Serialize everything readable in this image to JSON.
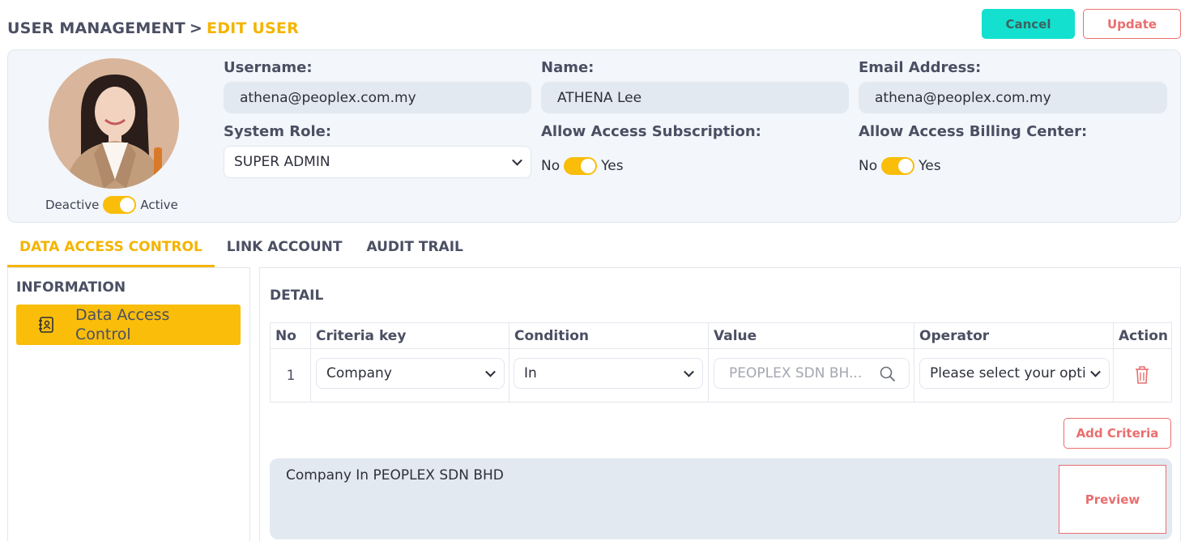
{
  "breadcrumb": {
    "root": "USER MANAGEMENT",
    "separator": ">",
    "current": "EDIT USER"
  },
  "actions": {
    "cancel_label": "Cancel",
    "update_label": "Update"
  },
  "profile": {
    "status_off_label": "Deactive",
    "status_on_label": "Active",
    "status_active": true,
    "username_label": "Username:",
    "username_value": "athena@peoplex.com.my",
    "name_label": "Name:",
    "name_value": "ATHENA Lee",
    "email_label": "Email Address:",
    "email_value": "athena@peoplex.com.my",
    "role_label": "System Role:",
    "role_value": "SUPER ADMIN",
    "subscription_label": "Allow Access Subscription:",
    "subscription_no": "No",
    "subscription_yes": "Yes",
    "subscription_enabled": true,
    "billing_label": "Allow Access Billing Center:",
    "billing_no": "No",
    "billing_yes": "Yes",
    "billing_enabled": true
  },
  "tabs": [
    {
      "label": "DATA ACCESS CONTROL",
      "active": true
    },
    {
      "label": "LINK ACCOUNT",
      "active": false
    },
    {
      "label": "AUDIT TRAIL",
      "active": false
    }
  ],
  "sidebar": {
    "title": "INFORMATION",
    "items": [
      {
        "label": "Data Access Control",
        "icon": "contact-book-icon",
        "active": true
      }
    ]
  },
  "detail": {
    "title": "DETAIL",
    "columns": [
      "No",
      "Criteria key",
      "Condition",
      "Value",
      "Operator",
      "Action"
    ],
    "rows": [
      {
        "no": "1",
        "criteria_key": "Company",
        "condition": "In",
        "value_placeholder": "PEOPLEX SDN BH...",
        "operator": "Please select your opti",
        "action_icon": "trash-icon"
      }
    ],
    "add_label": "Add Criteria",
    "preview_text": "Company In PEOPLEX SDN BHD",
    "preview_label": "Preview"
  },
  "colors": {
    "accent": "#f4b400",
    "toggle": "#f9bd0a",
    "teal": "#14e0cf",
    "danger": "#ea6e6e",
    "field_bg": "#e2e9f1"
  }
}
